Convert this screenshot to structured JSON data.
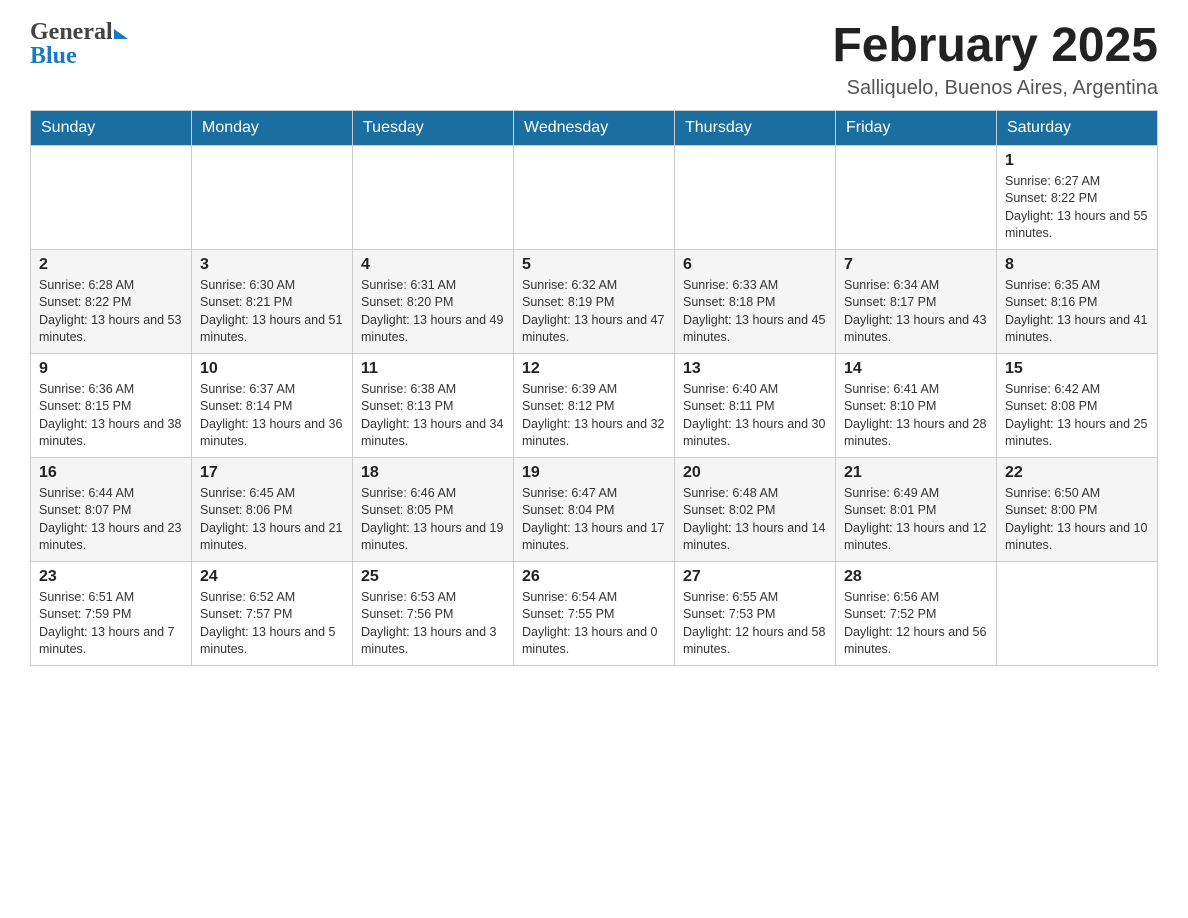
{
  "header": {
    "logo_general": "General",
    "logo_blue": "Blue",
    "month_title": "February 2025",
    "location": "Salliquelo, Buenos Aires, Argentina"
  },
  "days_of_week": [
    "Sunday",
    "Monday",
    "Tuesday",
    "Wednesday",
    "Thursday",
    "Friday",
    "Saturday"
  ],
  "weeks": [
    [
      {
        "day": "",
        "info": ""
      },
      {
        "day": "",
        "info": ""
      },
      {
        "day": "",
        "info": ""
      },
      {
        "day": "",
        "info": ""
      },
      {
        "day": "",
        "info": ""
      },
      {
        "day": "",
        "info": ""
      },
      {
        "day": "1",
        "info": "Sunrise: 6:27 AM\nSunset: 8:22 PM\nDaylight: 13 hours and 55 minutes."
      }
    ],
    [
      {
        "day": "2",
        "info": "Sunrise: 6:28 AM\nSunset: 8:22 PM\nDaylight: 13 hours and 53 minutes."
      },
      {
        "day": "3",
        "info": "Sunrise: 6:30 AM\nSunset: 8:21 PM\nDaylight: 13 hours and 51 minutes."
      },
      {
        "day": "4",
        "info": "Sunrise: 6:31 AM\nSunset: 8:20 PM\nDaylight: 13 hours and 49 minutes."
      },
      {
        "day": "5",
        "info": "Sunrise: 6:32 AM\nSunset: 8:19 PM\nDaylight: 13 hours and 47 minutes."
      },
      {
        "day": "6",
        "info": "Sunrise: 6:33 AM\nSunset: 8:18 PM\nDaylight: 13 hours and 45 minutes."
      },
      {
        "day": "7",
        "info": "Sunrise: 6:34 AM\nSunset: 8:17 PM\nDaylight: 13 hours and 43 minutes."
      },
      {
        "day": "8",
        "info": "Sunrise: 6:35 AM\nSunset: 8:16 PM\nDaylight: 13 hours and 41 minutes."
      }
    ],
    [
      {
        "day": "9",
        "info": "Sunrise: 6:36 AM\nSunset: 8:15 PM\nDaylight: 13 hours and 38 minutes."
      },
      {
        "day": "10",
        "info": "Sunrise: 6:37 AM\nSunset: 8:14 PM\nDaylight: 13 hours and 36 minutes."
      },
      {
        "day": "11",
        "info": "Sunrise: 6:38 AM\nSunset: 8:13 PM\nDaylight: 13 hours and 34 minutes."
      },
      {
        "day": "12",
        "info": "Sunrise: 6:39 AM\nSunset: 8:12 PM\nDaylight: 13 hours and 32 minutes."
      },
      {
        "day": "13",
        "info": "Sunrise: 6:40 AM\nSunset: 8:11 PM\nDaylight: 13 hours and 30 minutes."
      },
      {
        "day": "14",
        "info": "Sunrise: 6:41 AM\nSunset: 8:10 PM\nDaylight: 13 hours and 28 minutes."
      },
      {
        "day": "15",
        "info": "Sunrise: 6:42 AM\nSunset: 8:08 PM\nDaylight: 13 hours and 25 minutes."
      }
    ],
    [
      {
        "day": "16",
        "info": "Sunrise: 6:44 AM\nSunset: 8:07 PM\nDaylight: 13 hours and 23 minutes."
      },
      {
        "day": "17",
        "info": "Sunrise: 6:45 AM\nSunset: 8:06 PM\nDaylight: 13 hours and 21 minutes."
      },
      {
        "day": "18",
        "info": "Sunrise: 6:46 AM\nSunset: 8:05 PM\nDaylight: 13 hours and 19 minutes."
      },
      {
        "day": "19",
        "info": "Sunrise: 6:47 AM\nSunset: 8:04 PM\nDaylight: 13 hours and 17 minutes."
      },
      {
        "day": "20",
        "info": "Sunrise: 6:48 AM\nSunset: 8:02 PM\nDaylight: 13 hours and 14 minutes."
      },
      {
        "day": "21",
        "info": "Sunrise: 6:49 AM\nSunset: 8:01 PM\nDaylight: 13 hours and 12 minutes."
      },
      {
        "day": "22",
        "info": "Sunrise: 6:50 AM\nSunset: 8:00 PM\nDaylight: 13 hours and 10 minutes."
      }
    ],
    [
      {
        "day": "23",
        "info": "Sunrise: 6:51 AM\nSunset: 7:59 PM\nDaylight: 13 hours and 7 minutes."
      },
      {
        "day": "24",
        "info": "Sunrise: 6:52 AM\nSunset: 7:57 PM\nDaylight: 13 hours and 5 minutes."
      },
      {
        "day": "25",
        "info": "Sunrise: 6:53 AM\nSunset: 7:56 PM\nDaylight: 13 hours and 3 minutes."
      },
      {
        "day": "26",
        "info": "Sunrise: 6:54 AM\nSunset: 7:55 PM\nDaylight: 13 hours and 0 minutes."
      },
      {
        "day": "27",
        "info": "Sunrise: 6:55 AM\nSunset: 7:53 PM\nDaylight: 12 hours and 58 minutes."
      },
      {
        "day": "28",
        "info": "Sunrise: 6:56 AM\nSunset: 7:52 PM\nDaylight: 12 hours and 56 minutes."
      },
      {
        "day": "",
        "info": ""
      }
    ]
  ]
}
